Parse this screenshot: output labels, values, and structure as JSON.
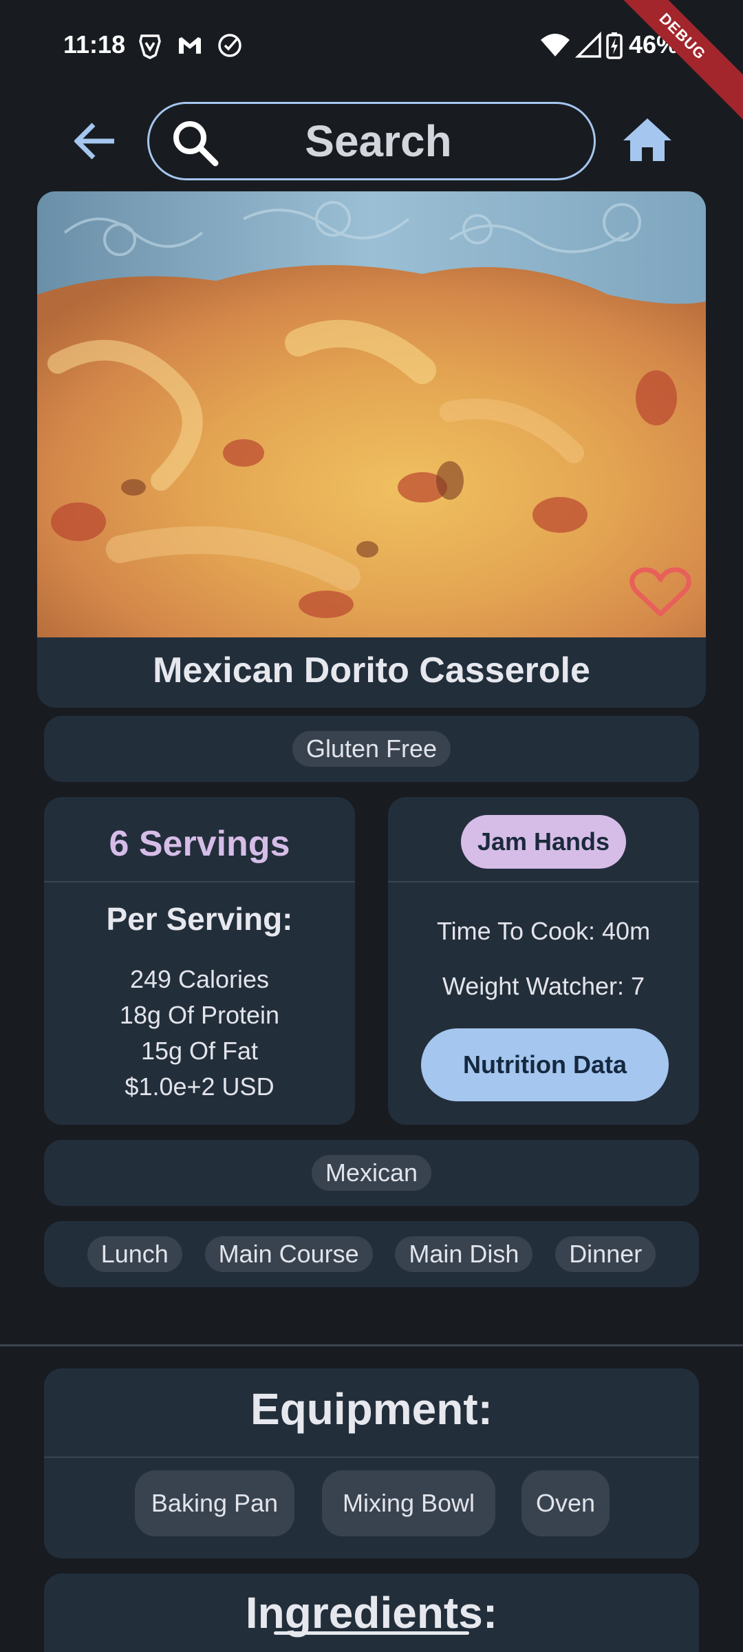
{
  "status_bar": {
    "time": "11:18",
    "battery": "46%",
    "debug_label": "DEBUG",
    "notification_icons": [
      "brave-icon",
      "gmail-icon",
      "check-circle-icon"
    ],
    "system_icons": [
      "wifi-icon",
      "cell-signal-icon",
      "battery-charging-icon"
    ]
  },
  "top_bar": {
    "search_text": "Search"
  },
  "recipe": {
    "title": "Mexican Dorito Casserole",
    "favorite": false,
    "diet_tags": [
      "Gluten Free"
    ],
    "servings": "6 Servings",
    "per_serving_label": "Per Serving:",
    "calories": "249 Calories",
    "protein": "18g Of Protein",
    "fat": "15g Of Fat",
    "price": "$1.0e+2 USD",
    "author": "Jam Hands",
    "time_to_cook": "Time To Cook: 40m",
    "weight_watcher": "Weight Watcher: 7",
    "nutrition_button": "Nutrition Data",
    "cuisines": [
      "Mexican"
    ],
    "dish_types": [
      "Lunch",
      "Main Course",
      "Main Dish",
      "Dinner"
    ]
  },
  "equipment": {
    "title": "Equipment:",
    "items": [
      "Baking Pan",
      "Mixing Bowl",
      "Oven"
    ]
  },
  "ingredients": {
    "title": "Ingredients:"
  },
  "colors": {
    "background": "#181c21",
    "card": "#232e3b",
    "accent_blue": "#a5c6ee",
    "accent_purple": "#d6bde8",
    "chip": "#394350",
    "heart": "#e8605a"
  }
}
